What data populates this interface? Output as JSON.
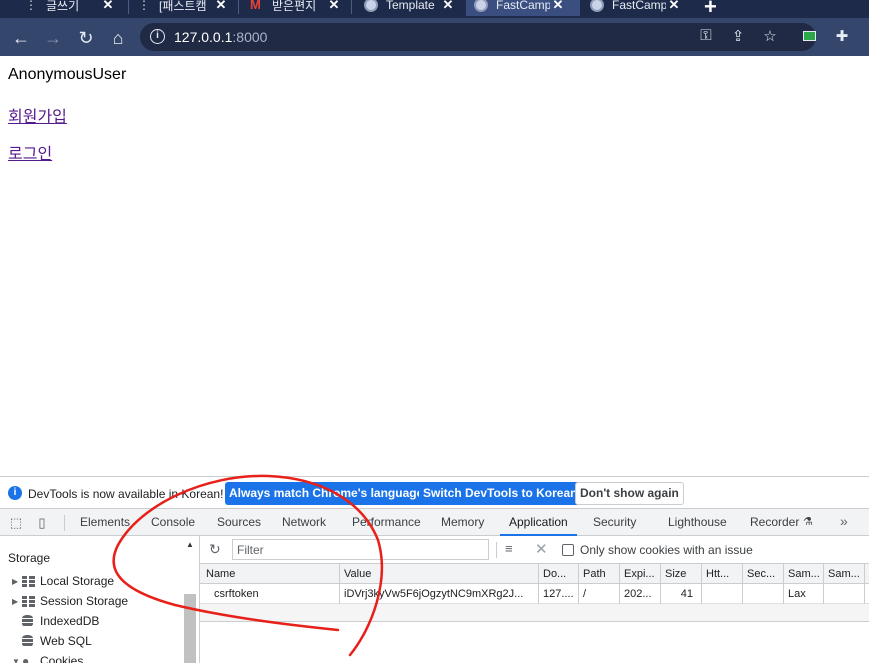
{
  "browser": {
    "tabs": [
      {
        "title": "글쓰기"
      },
      {
        "title": "[패스트캠"
      },
      {
        "title": "받은편지"
      },
      {
        "title": "Template"
      },
      {
        "title": "FastCamp"
      },
      {
        "title": "FastCamp"
      }
    ],
    "newtab_label": "+",
    "url_host": "127.0.0.1",
    "url_port": ":8000"
  },
  "page": {
    "username": "AnonymousUser",
    "signup_link": "회원가입",
    "login_link": "로그인"
  },
  "devtools": {
    "infobar": {
      "message": "DevTools is now available in Korean!",
      "match_button": "Always match Chrome's language",
      "switch_button": "Switch DevTools to Korean",
      "dismiss_button": "Don't show again"
    },
    "tabs": [
      "Elements",
      "Console",
      "Sources",
      "Network",
      "Performance",
      "Memory",
      "Application",
      "Security",
      "Lighthouse",
      "Recorder"
    ],
    "active_tab": "Application",
    "sidebar": {
      "title": "Storage",
      "items": [
        "Local Storage",
        "Session Storage",
        "IndexedDB",
        "Web SQL",
        "Cookies"
      ]
    },
    "cookies": {
      "filter_placeholder": "Filter",
      "only_issue_label": "Only show cookies with an issue",
      "columns": [
        "Name",
        "Value",
        "Do...",
        "Path",
        "Expi...",
        "Size",
        "Htt...",
        "Sec...",
        "Sam...",
        "Sam..."
      ],
      "rows": [
        [
          "csrftoken",
          "iDVrj3kyVw5F6jOgzytNC9mXRg2J...",
          "127....",
          "/",
          "202...",
          "41",
          "",
          "",
          "Lax",
          ""
        ]
      ]
    }
  },
  "colors": {
    "tabstrip": "#1d2a4a",
    "toolbar": "#35466d",
    "devtools_accent": "#1a73e8",
    "annotation": "#e8201a",
    "visited_link": "#551a8b"
  }
}
